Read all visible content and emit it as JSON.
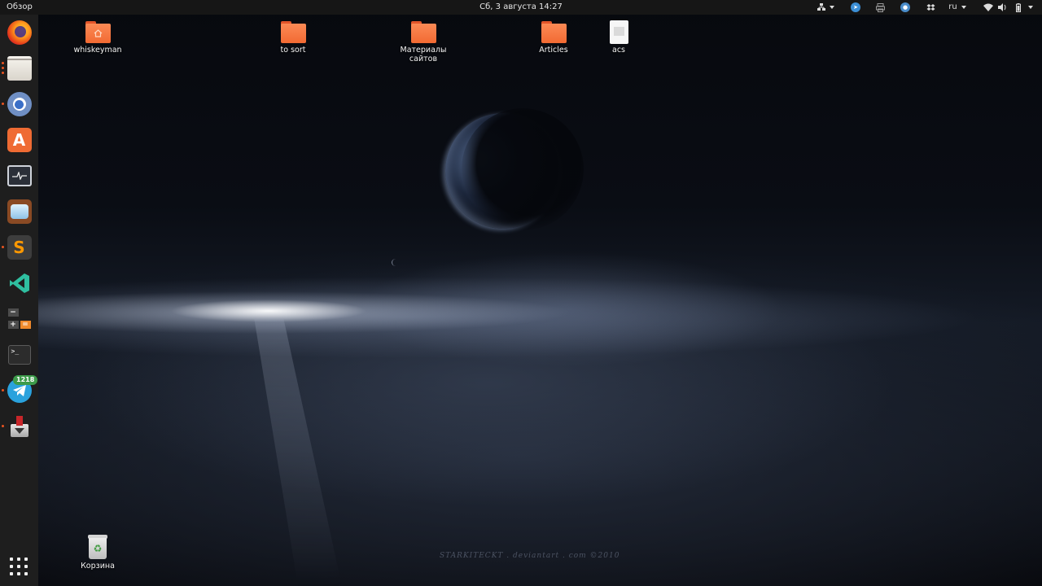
{
  "topbar": {
    "activities_label": "Обзор",
    "clock": "Сб, 3 августа  14:27",
    "language": "ru",
    "tray_icons": [
      "network-manager-icon",
      "telegram-tray-icon",
      "printer-icon",
      "chrome-tray-icon",
      "dropbox-icon",
      "wifi-icon",
      "volume-icon",
      "battery-icon"
    ]
  },
  "dock": {
    "apps": [
      {
        "name": "firefox",
        "icon": "firefox-icon",
        "running": false
      },
      {
        "name": "files",
        "icon": "files-icon",
        "running": true
      },
      {
        "name": "chromium",
        "icon": "chromium-icon",
        "running": true
      },
      {
        "name": "ubuntu-software",
        "icon": "software-center-icon",
        "running": false
      },
      {
        "name": "system-monitor",
        "icon": "system-monitor-icon",
        "running": false
      },
      {
        "name": "remmina",
        "icon": "remote-desktop-icon",
        "running": false
      },
      {
        "name": "sublime-text",
        "icon": "sublime-text-icon",
        "running": true,
        "glyph": "S"
      },
      {
        "name": "vscode",
        "icon": "vscode-icon",
        "running": false
      },
      {
        "name": "calculator",
        "icon": "calculator-icon",
        "running": false
      },
      {
        "name": "terminal",
        "icon": "terminal-icon",
        "running": false,
        "glyph": ">_"
      },
      {
        "name": "telegram",
        "icon": "telegram-icon",
        "running": true
      },
      {
        "name": "transmission",
        "icon": "transmission-icon",
        "running": true
      }
    ],
    "telegram_badge": "1218"
  },
  "desktop": {
    "icons": [
      {
        "label": "whiskeyman",
        "type": "home-folder"
      },
      {
        "label": "to sort",
        "type": "folder"
      },
      {
        "label": "Материалы сайтов",
        "type": "folder"
      },
      {
        "label": "Articles",
        "type": "folder"
      },
      {
        "label": "acs",
        "type": "document"
      }
    ],
    "trash_label": "Корзина"
  },
  "wallpaper": {
    "watermark": "STARKITECKT . deviantart . com ©2010"
  },
  "colors": {
    "folder": "#f26a33",
    "dock_bg": "#1e1e1e",
    "topbar_bg": "#161616",
    "running_indicator": "#e95420",
    "badge": "#3d9b4a"
  }
}
